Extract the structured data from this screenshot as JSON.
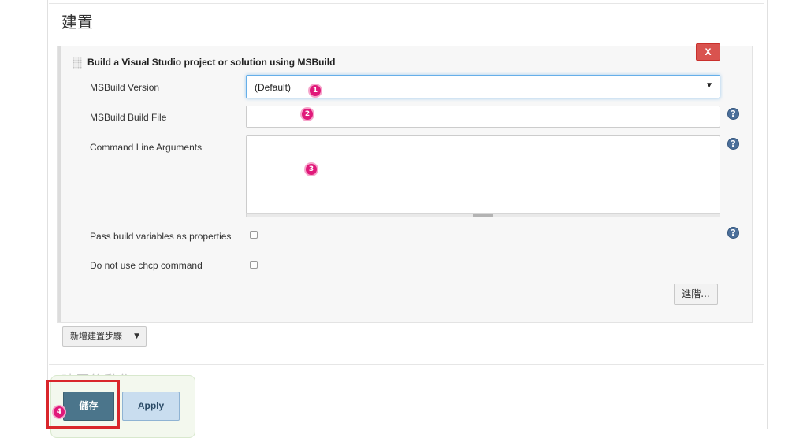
{
  "section": {
    "title": "建置"
  },
  "build_step": {
    "heading": "Build a Visual Studio project or solution using MSBuild",
    "delete_label": "X",
    "fields": {
      "msbuild_version": {
        "label": "MSBuild Version",
        "value": "(Default)"
      },
      "build_file": {
        "label": "MSBuild Build File",
        "value": ""
      },
      "cmd_args": {
        "label": "Command Line Arguments",
        "value": ""
      },
      "pass_vars": {
        "label": "Pass build variables as properties",
        "checked": false
      },
      "no_chcp": {
        "label": "Do not use chcp command",
        "checked": false
      }
    },
    "help_symbol": "?",
    "advanced_label": "進階..."
  },
  "add_step": {
    "label": "新增建置步驟",
    "caret": "▼"
  },
  "post_build": {
    "title": "建置後動作"
  },
  "actions": {
    "save_label": "儲存",
    "apply_label": "Apply"
  },
  "markers": [
    "1",
    "2",
    "3",
    "4"
  ],
  "icons": {
    "help": "help-circle-icon",
    "dropdown": "caret-down-icon",
    "drag": "drag-handle-icon"
  },
  "colors": {
    "delete": "#d9534f",
    "save": "#4b758b",
    "apply": "#c9ddef",
    "marker": "#e0197a",
    "highlight": "#d9262b",
    "help": "#4b6f9a"
  }
}
